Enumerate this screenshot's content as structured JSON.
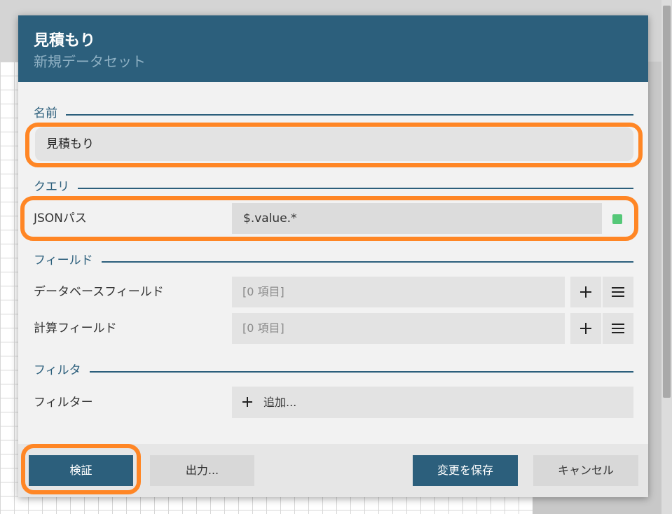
{
  "dialog": {
    "title": "見積もり",
    "subtitle": "新規データセット"
  },
  "name_section": {
    "label": "名前",
    "value": "見積もり"
  },
  "query_section": {
    "label": "クエリ",
    "json_path_label": "JSONパス",
    "json_path_value": "$.value.*",
    "status_color": "#55c878"
  },
  "fields_section": {
    "label": "フィールド",
    "database_fields_label": "データベースフィールド",
    "database_fields_value": "[0 項目]",
    "calculated_fields_label": "計算フィールド",
    "calculated_fields_value": "[0 項目]"
  },
  "filter_section": {
    "label": "フィルタ",
    "filter_label": "フィルター",
    "add_label": "追加..."
  },
  "footer": {
    "validate_label": "検証",
    "export_label": "出力...",
    "save_label": "変更を保存",
    "cancel_label": "キャンセル"
  },
  "colors": {
    "accent": "#2c5f7c",
    "highlight": "#ff8625",
    "status_ok": "#55c878"
  }
}
